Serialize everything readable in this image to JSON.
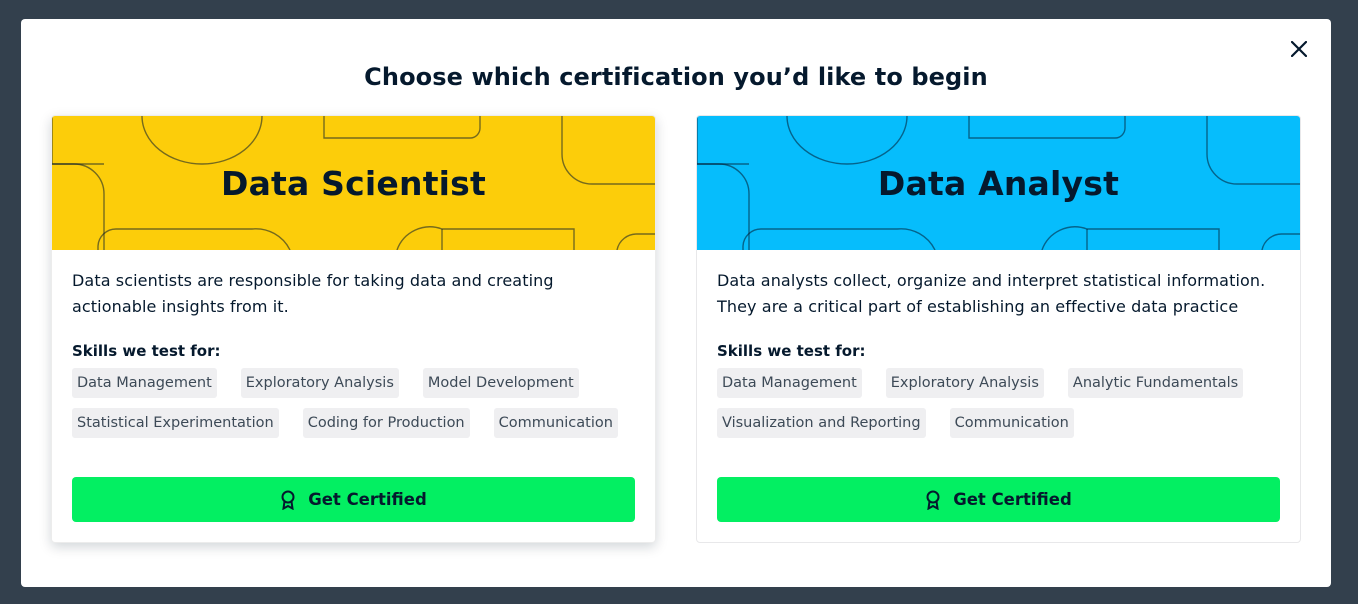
{
  "modal": {
    "title": "Choose which certification you’d like to begin",
    "close_icon": "close-icon"
  },
  "cards": [
    {
      "title": "Data Scientist",
      "banner_color": "#fccd0a",
      "description": "Data scientists are responsible for taking data and creating actionable insights from it.",
      "skills_label": "Skills we test for:",
      "skills": [
        "Data Management",
        "Exploratory Analysis",
        "Model Development",
        "Statistical Experimentation",
        "Coding for Production",
        "Communication"
      ],
      "cta_label": "Get Certified",
      "cta_icon": "award-icon"
    },
    {
      "title": "Data Analyst",
      "banner_color": "#06bdfc",
      "description": "Data analysts collect, organize and interpret statistical information. They are a critical part of establishing an effective data practice",
      "skills_label": "Skills we test for:",
      "skills": [
        "Data Management",
        "Exploratory Analysis",
        "Analytic Fundamentals",
        "Visualization and Reporting",
        "Communication"
      ],
      "cta_label": "Get Certified",
      "cta_icon": "award-icon"
    }
  ],
  "colors": {
    "backdrop": "#33404d",
    "cta": "#03ef62",
    "text": "#05192d",
    "tag_bg": "#efeff1"
  }
}
